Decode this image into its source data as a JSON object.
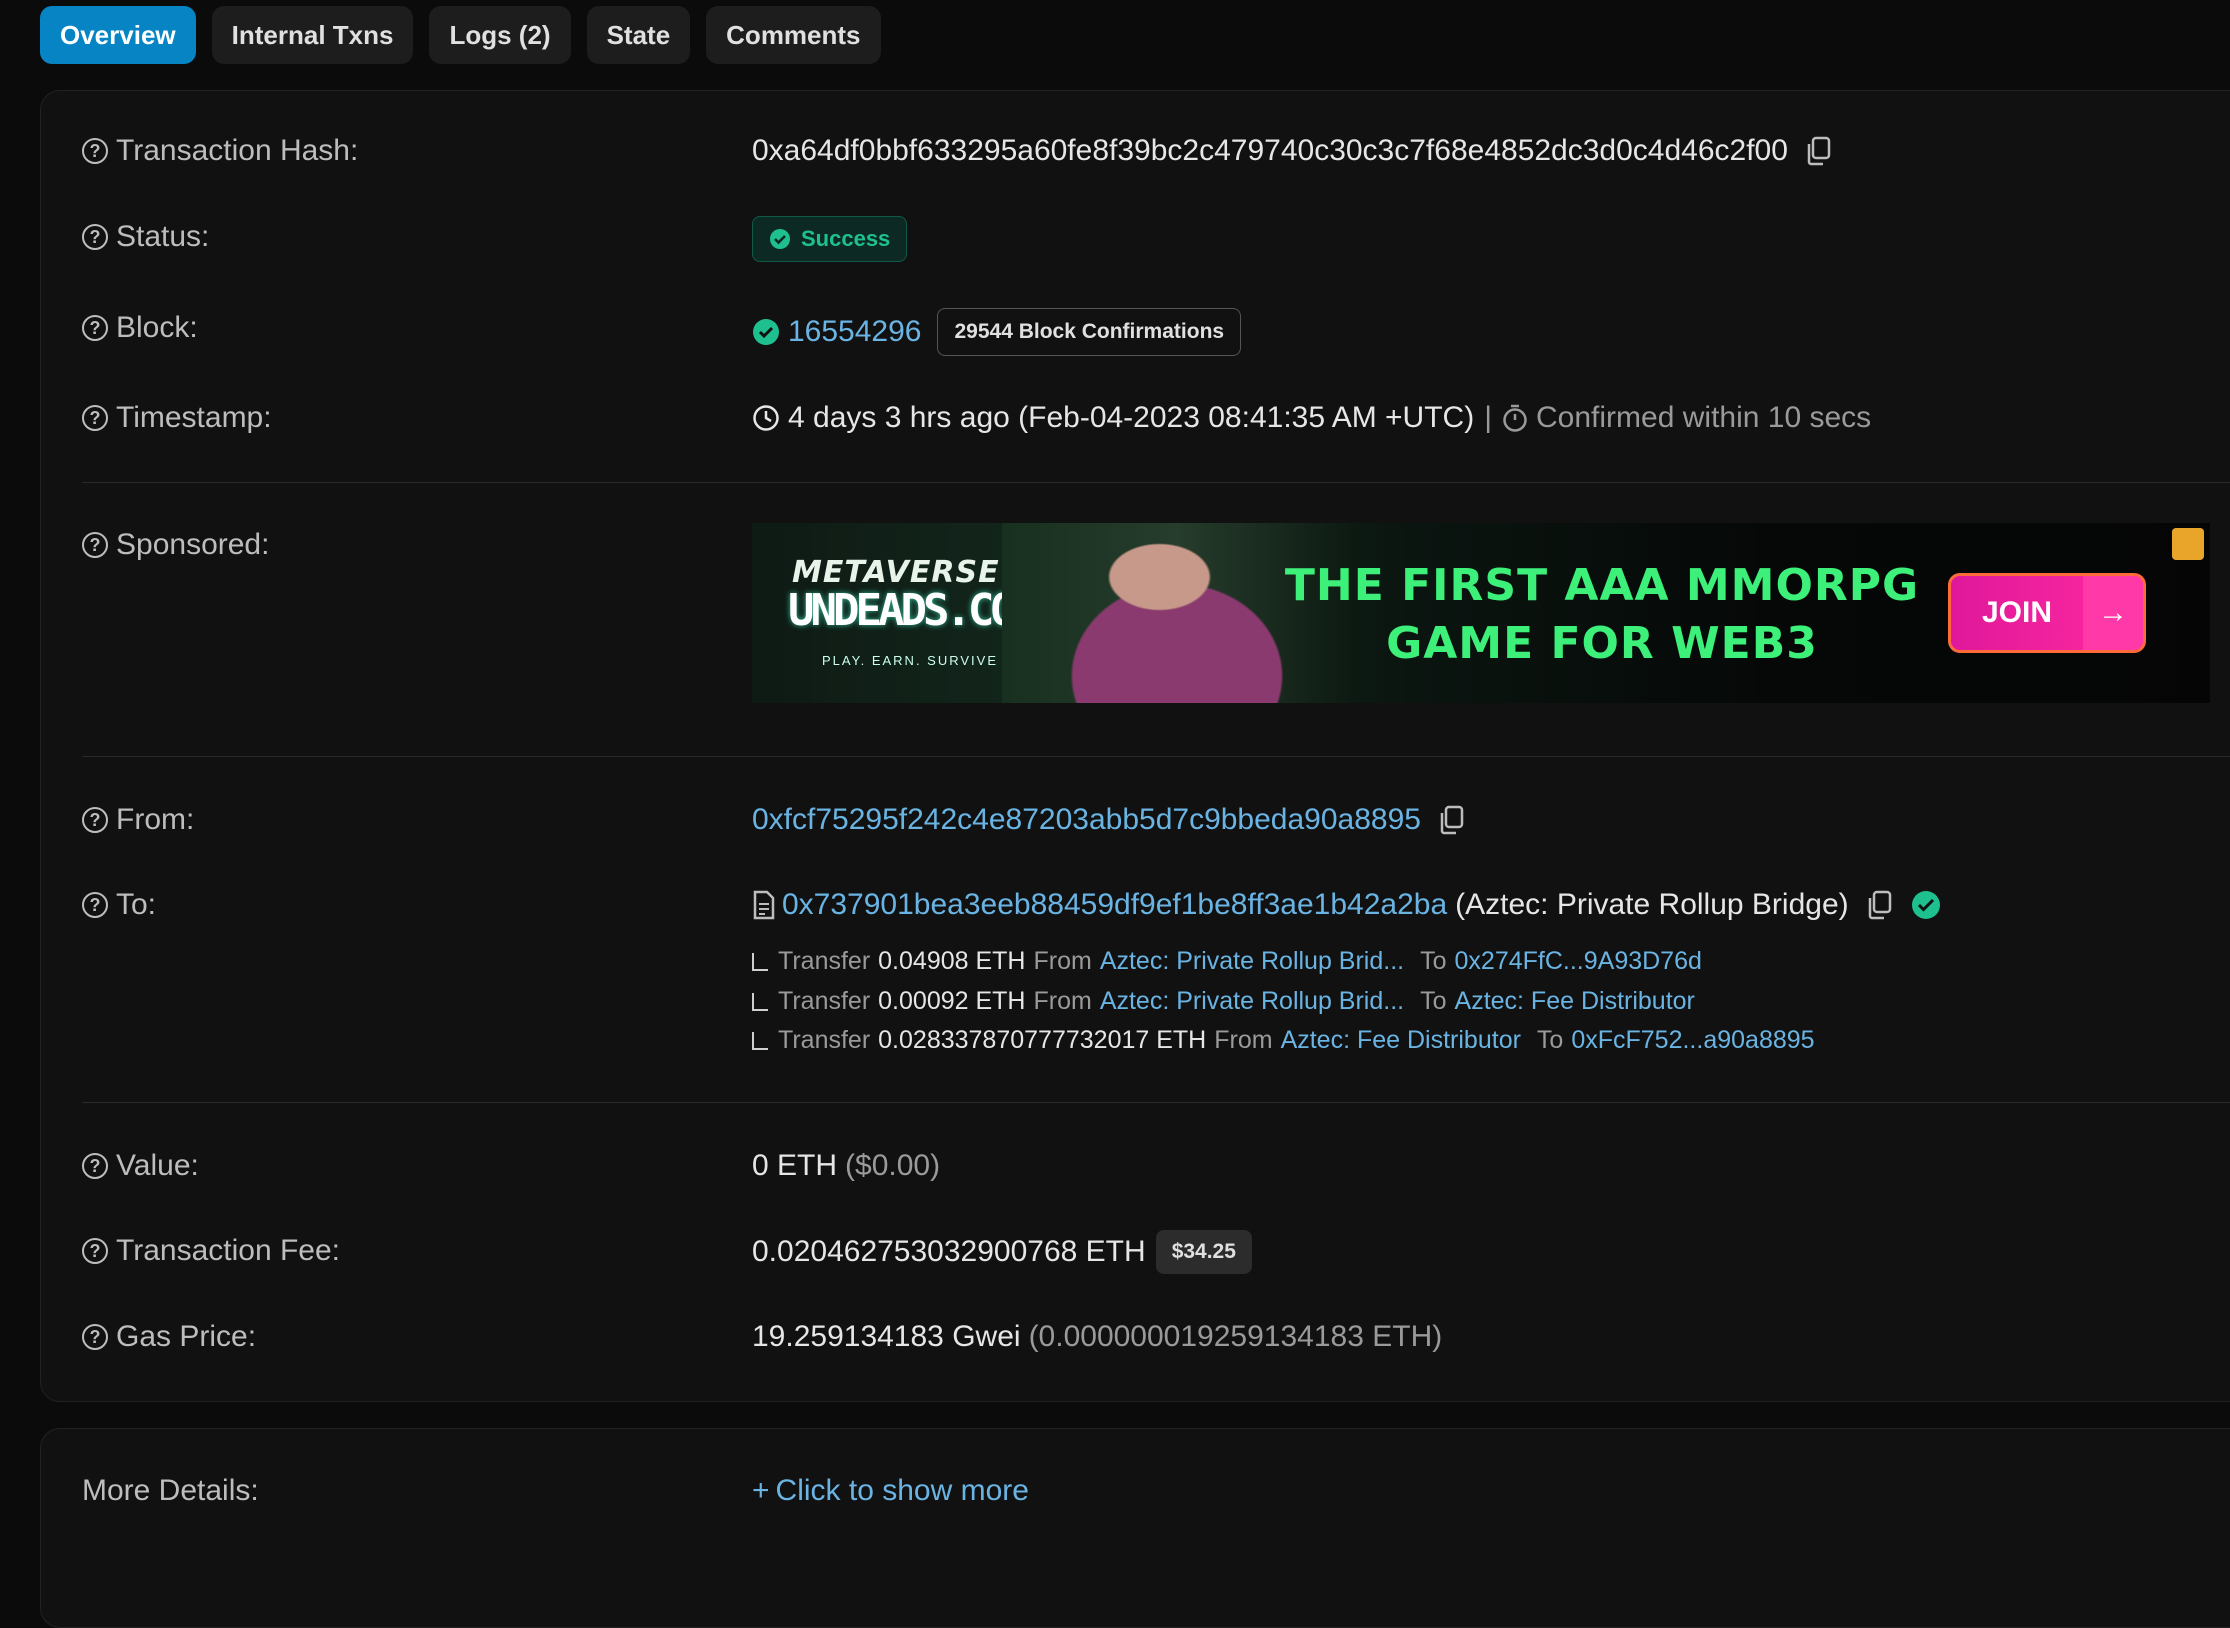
{
  "tabs": [
    {
      "label": "Overview",
      "active": true
    },
    {
      "label": "Internal Txns"
    },
    {
      "label": "Logs (2)"
    },
    {
      "label": "State"
    },
    {
      "label": "Comments"
    }
  ],
  "rows": {
    "tx_hash": {
      "label": "Transaction Hash:",
      "value": "0xa64df0bbf633295a60fe8f39bc2c479740c30c3c7f68e4852dc3d0c4d46c2f00"
    },
    "status": {
      "label": "Status:",
      "value": "Success"
    },
    "block": {
      "label": "Block:",
      "value": "16554296",
      "confirmations": "29544 Block Confirmations"
    },
    "timestamp": {
      "label": "Timestamp:",
      "value": "4 days 3 hrs ago (Feb-04-2023 08:41:35 AM +UTC)",
      "separator": "|",
      "confirmed": "Confirmed within 10 secs"
    },
    "sponsored": {
      "label": "Sponsored:"
    },
    "from": {
      "label": "From:",
      "value": "0xfcf75295f242c4e87203abb5d7c9bbeda90a8895"
    },
    "to": {
      "label": "To:",
      "value": "0x737901bea3eeb88459df9ef1be8ff3ae1b42a2ba",
      "name": "(Aztec: Private Rollup Bridge)"
    },
    "value": {
      "label": "Value:",
      "value": "0 ETH",
      "usd": "($0.00)"
    },
    "fee": {
      "label": "Transaction Fee:",
      "value": "0.020462753032900768 ETH",
      "usd": "$34.25"
    },
    "gas": {
      "label": "Gas Price:",
      "value": "19.259134183 Gwei",
      "eth": "(0.000000019259134183 ETH)"
    }
  },
  "transfers": [
    {
      "word": "Transfer",
      "amount": "0.04908 ETH",
      "from_word": "From",
      "from": "Aztec: Private Rollup Brid...",
      "to_word": "To",
      "to": "0x274FfC...9A93D76d"
    },
    {
      "word": "Transfer",
      "amount": "0.00092 ETH",
      "from_word": "From",
      "from": "Aztec: Private Rollup Brid...",
      "to_word": "To",
      "to": "Aztec: Fee Distributor"
    },
    {
      "word": "Transfer",
      "amount": "0.028337870777732017 ETH",
      "from_word": "From",
      "from": "Aztec: Fee Distributor",
      "to_word": "To",
      "to": "0xFcF752...a90a8895"
    }
  ],
  "ad": {
    "logo_top": "METAVERSE",
    "logo": "UNDEADS.COM",
    "logo_sub": "PLAY. EARN. SURVIVE",
    "headline_1": "THE FIRST AAA MMORPG",
    "headline_2": "GAME FOR WEB3",
    "cta": "JOIN"
  },
  "more": {
    "label": "More Details:",
    "link": "Click to show more",
    "plus": "+"
  },
  "colors": {
    "accent": "#0784c3",
    "link": "#6ab4e4",
    "success": "#1fc08f"
  }
}
